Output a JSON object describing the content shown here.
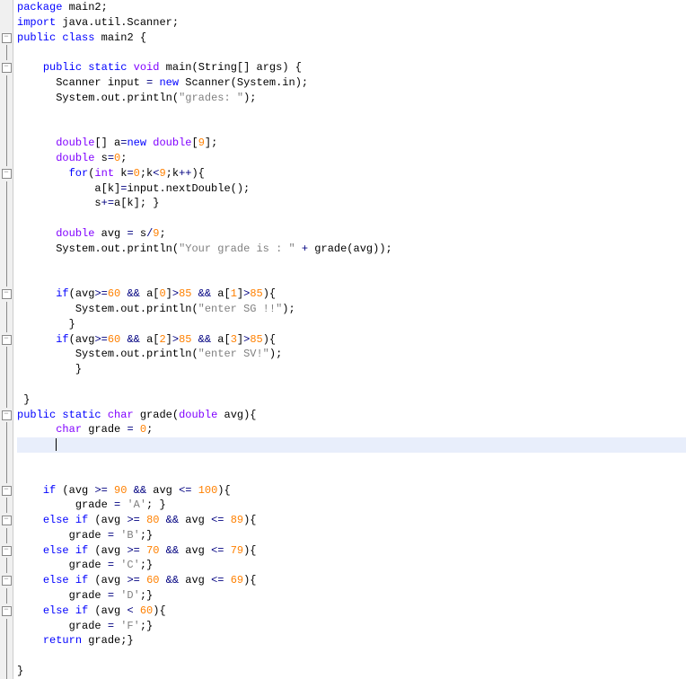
{
  "gutter": {
    "fold_minus": "⊟",
    "fold_open": "⊟"
  },
  "code": {
    "l1_pkg": "package",
    "l1_name": " main2",
    "l1_sc": ";",
    "l2_imp": "import",
    "l2_name": " java.util.Scanner",
    "l2_sc": ";",
    "l3_pub": "public",
    "l3_cls": "class",
    "l3_name": " main2 ",
    "l3_ob": "{",
    "l5_ind": "    ",
    "l5_pub": "public",
    "l5_stat": "static",
    "l5_void": "void",
    "l5_main": " main",
    "l5_op": "(",
    "l5_str": "String",
    "l5_args": "[] args",
    "l5_cp": ") {",
    "l6_ind": "      ",
    "l6_txt1": "Scanner input ",
    "l6_eq": "=",
    "l6_sp": " ",
    "l6_new": "new",
    "l6_txt2": " Scanner",
    "l6_op": "(",
    "l6_sys": "System",
    "l6_in": ".in",
    "l6_cp": ");",
    "l7_ind": "      ",
    "l7_sys": "System",
    "l7_out": ".out.println",
    "l7_op": "(",
    "l7_str": "\"grades: \"",
    "l7_cp": ");",
    "l9_ind": "      ",
    "l9_dbl": "double",
    "l9_arr": "[] a",
    "l9_eq": "=",
    "l9_new": "new",
    "l9_sp": " ",
    "l9_dbl2": "double",
    "l9_ob": "[",
    "l9_9": "9",
    "l9_cb": "];",
    "l10_ind": "      ",
    "l10_dbl": "double",
    "l10_s": " s",
    "l10_eq": "=",
    "l10_0": "0",
    "l10_sc": ";",
    "l11_ind": "        ",
    "l11_for": "for",
    "l11_op": "(",
    "l11_int": "int",
    "l11_k": " k",
    "l11_eq": "=",
    "l11_0": "0",
    "l11_sc1": ";k",
    "l11_lt": "<",
    "l11_9": "9",
    "l11_sc2": ";k",
    "l11_pp": "++",
    "l11_cp": "){",
    "l12_ind": "            ",
    "l12_txt": "a[k]",
    "l12_eq": "=",
    "l12_inp": "input.nextDouble",
    "l12_op": "();",
    "l13_ind": "            ",
    "l13_s": "s",
    "l13_pe": "+=",
    "l13_ak": "a[k]",
    "l13_sc": "; }",
    "l15_ind": "      ",
    "l15_dbl": "double",
    "l15_avg": " avg ",
    "l15_eq": "=",
    "l15_s9": " s",
    "l15_div": "/",
    "l15_9": "9",
    "l15_sc": ";",
    "l16_ind": "      ",
    "l16_sys": "System",
    "l16_out": ".out.println",
    "l16_op": "(",
    "l16_str": "\"Your grade is : \"",
    "l16_plus": " + ",
    "l16_gr": "grade(avg)",
    "l16_cp": ");",
    "l19_ind": "      ",
    "l19_if": "if",
    "l19_op": "(avg",
    "l19_ge": ">=",
    "l19_60": "60",
    "l19_and1": " && ",
    "l19_a0": "a[",
    "l19_0": "0",
    "l19_cb0": "]",
    "l19_gt1": ">",
    "l19_85a": "85",
    "l19_and2": " && ",
    "l19_a1": "a[",
    "l19_1": "1",
    "l19_cb1": "]",
    "l19_gt2": ">",
    "l19_85b": "85",
    "l19_cp": "){",
    "l20_ind": "         ",
    "l20_sys": "System",
    "l20_out": ".out.println",
    "l20_op": "(",
    "l20_str": "\"enter SG !!\"",
    "l20_cp": ");",
    "l21_ind": "        ",
    "l21_cb": "}",
    "l22_ind": "      ",
    "l22_if": "if",
    "l22_op": "(avg",
    "l22_ge": ">=",
    "l22_60": "60",
    "l22_and1": " && ",
    "l22_a2": "a[",
    "l22_2": "2",
    "l22_cb2": "]",
    "l22_gt1": ">",
    "l22_85a": "85",
    "l22_and2": " && ",
    "l22_a3": "a[",
    "l22_3": "3",
    "l22_cb3": "]",
    "l22_gt2": ">",
    "l22_85b": "85",
    "l22_cp": "){",
    "l23_ind": "         ",
    "l23_sys": "System",
    "l23_out": ".out.println",
    "l23_op": "(",
    "l23_str": "\"enter SV!\"",
    "l23_cp": ");",
    "l24_ind": "         ",
    "l24_cb": "}",
    "l26_cb": " }",
    "l27_pub": "public",
    "l27_stat": "static",
    "l27_char": "char",
    "l27_gr": " grade",
    "l27_op": "(",
    "l27_dbl": "double",
    "l27_avg": " avg",
    "l27_cp": "){",
    "l28_ind": "      ",
    "l28_char": "char",
    "l28_gr": " grade ",
    "l28_eq": "=",
    "l28_sp": " ",
    "l28_0": "0",
    "l28_sc": ";",
    "l31_ind": "    ",
    "l31_if": "if",
    "l31_op": " (avg ",
    "l31_ge": ">=",
    "l31_sp1": " ",
    "l31_90": "90",
    "l31_and": " && ",
    "l31_avg2": "avg ",
    "l31_le": "<=",
    "l31_sp2": " ",
    "l31_100": "100",
    "l31_cp": "){",
    "l32_ind": "         ",
    "l32_gr": "grade ",
    "l32_eq": "=",
    "l32_sp": " ",
    "l32_a": "'A'",
    "l32_sc": "; }",
    "l33_ind": "    ",
    "l33_else": "else",
    "l33_sp": " ",
    "l33_if": "if",
    "l33_op": " (avg ",
    "l33_ge": ">=",
    "l33_sp1": " ",
    "l33_80": "80",
    "l33_and": " && ",
    "l33_avg2": "avg ",
    "l33_le": "<=",
    "l33_sp2": " ",
    "l33_89": "89",
    "l33_cp": "){",
    "l34_ind": "        ",
    "l34_gr": "grade ",
    "l34_eq": "=",
    "l34_sp": " ",
    "l34_b": "'B'",
    "l34_sc": ";}",
    "l35_ind": "    ",
    "l35_else": "else",
    "l35_sp": " ",
    "l35_if": "if",
    "l35_op": " (avg ",
    "l35_ge": ">=",
    "l35_sp1": " ",
    "l35_70": "70",
    "l35_and": " && ",
    "l35_avg2": "avg ",
    "l35_le": "<=",
    "l35_sp2": " ",
    "l35_79": "79",
    "l35_cp": "){",
    "l36_ind": "        ",
    "l36_gr": "grade ",
    "l36_eq": "=",
    "l36_sp": " ",
    "l36_c": "'C'",
    "l36_sc": ";}",
    "l37_ind": "    ",
    "l37_else": "else",
    "l37_sp": " ",
    "l37_if": "if",
    "l37_op": " (avg ",
    "l37_ge": ">=",
    "l37_sp1": " ",
    "l37_60": "60",
    "l37_and": " && ",
    "l37_avg2": "avg ",
    "l37_le": "<=",
    "l37_sp2": " ",
    "l37_69": "69",
    "l37_cp": "){",
    "l38_ind": "        ",
    "l38_gr": "grade ",
    "l38_eq": "=",
    "l38_sp": " ",
    "l38_d": "'D'",
    "l38_sc": ";}",
    "l39_ind": "    ",
    "l39_else": "else",
    "l39_sp": " ",
    "l39_if": "if",
    "l39_op": " (avg ",
    "l39_lt": "<",
    "l39_sp1": " ",
    "l39_60": "60",
    "l39_cp": "){",
    "l40_ind": "        ",
    "l40_gr": "grade ",
    "l40_eq": "=",
    "l40_sp": " ",
    "l40_f": "'F'",
    "l40_sc": ";}",
    "l41_ind": "    ",
    "l41_ret": "return",
    "l41_gr": " grade",
    "l41_sc": ";}",
    "l43_cb": "}"
  }
}
